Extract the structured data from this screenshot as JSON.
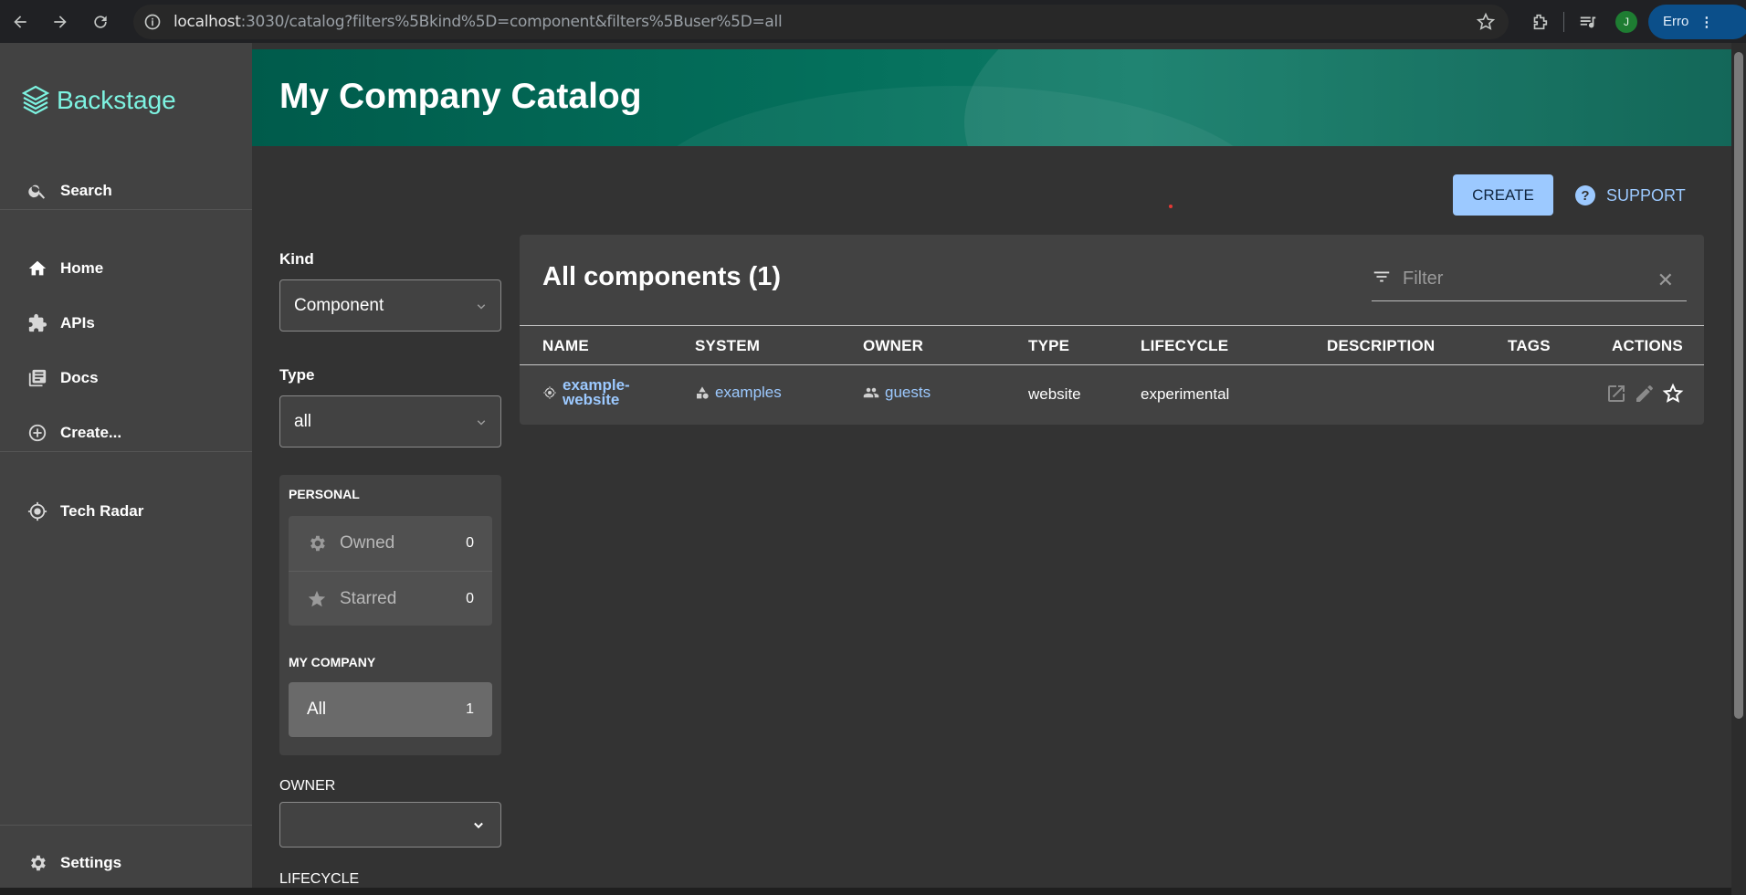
{
  "browser": {
    "url_host": "localhost",
    "url_rest": ":3030/catalog?filters%5Bkind%5D=component&filters%5Buser%5D=all",
    "profile_initial": "J",
    "profile_label": "Erro"
  },
  "sidebar": {
    "logo_text": "Backstage",
    "search_label": "Search",
    "items": [
      {
        "label": "Home",
        "icon": "home-icon"
      },
      {
        "label": "APIs",
        "icon": "puzzle-icon"
      },
      {
        "label": "Docs",
        "icon": "docs-icon"
      },
      {
        "label": "Create...",
        "icon": "add-circle-icon"
      }
    ],
    "tech_radar_label": "Tech Radar",
    "settings_label": "Settings"
  },
  "header": {
    "title": "My Company Catalog"
  },
  "actions": {
    "create_label": "CREATE",
    "support_label": "SUPPORT"
  },
  "filters": {
    "kind_label": "Kind",
    "kind_value": "Component",
    "type_label": "Type",
    "type_value": "all",
    "personal_heading": "PERSONAL",
    "owned_label": "Owned",
    "owned_count": "0",
    "starred_label": "Starred",
    "starred_count": "0",
    "company_heading": "MY COMPANY",
    "all_label": "All",
    "all_count": "1",
    "owner_label": "OWNER",
    "lifecycle_label": "LIFECYCLE"
  },
  "table": {
    "title": "All components (1)",
    "filter_placeholder": "Filter",
    "columns": [
      "NAME",
      "SYSTEM",
      "OWNER",
      "TYPE",
      "LIFECYCLE",
      "DESCRIPTION",
      "TAGS",
      "ACTIONS"
    ],
    "rows": [
      {
        "name_line1": "example-",
        "name_line2": "website",
        "system": "examples",
        "owner": "guests",
        "type": "website",
        "lifecycle": "experimental",
        "description": "",
        "tags": ""
      }
    ]
  },
  "colors": {
    "accent": "#9cc9ff",
    "logo": "#7df3e1",
    "header": "#005b4b",
    "sidebar": "#424242",
    "background": "#333333"
  }
}
